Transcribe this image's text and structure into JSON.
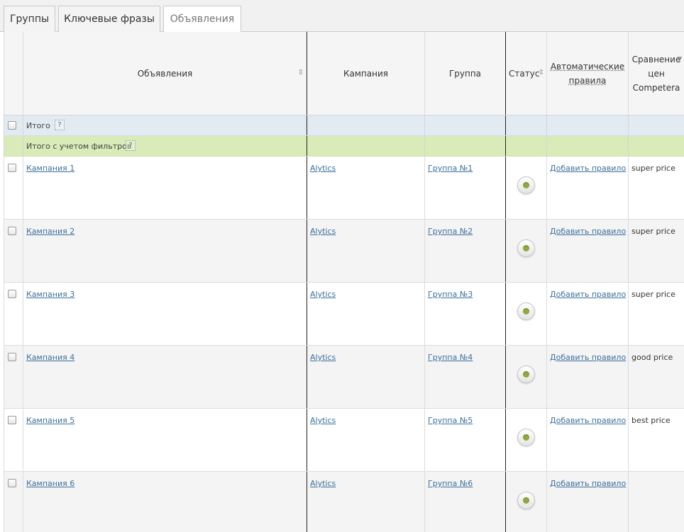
{
  "tabs": [
    "Группы",
    "Ключевые фразы",
    "Объявления"
  ],
  "header": {
    "ads": "Объявления",
    "campaign": "Кампания",
    "group": "Группа",
    "status": "Статус",
    "rules_line1": "Автоматические",
    "rules_line2": "правила",
    "compare_line1": "Сравнение",
    "compare_line2": "цен",
    "compare_line3": "Competera"
  },
  "summary": {
    "total_label": "Итого",
    "filtered_label": "Итого с учетом фильтров",
    "help": "?"
  },
  "rows": [
    {
      "ad": "Кампания 1",
      "campaign": "Alytics",
      "group": "Группа №1",
      "rule": "Добавить правило",
      "price": "super price"
    },
    {
      "ad": "Кампания 2",
      "campaign": "Alytics",
      "group": "Группа №2",
      "rule": "Добавить правило",
      "price": "super price"
    },
    {
      "ad": "Кампания 3",
      "campaign": "Alytics",
      "group": "Группа №3",
      "rule": "Добавить правило",
      "price": "super price"
    },
    {
      "ad": "Кампания 4",
      "campaign": "Alytics",
      "group": "Группа №4",
      "rule": "Добавить правило",
      "price": "good price"
    },
    {
      "ad": "Кампания 5",
      "campaign": "Alytics",
      "group": "Группа №5",
      "rule": "Добавить правило",
      "price": "best price"
    },
    {
      "ad": "Кампания 6",
      "campaign": "Alytics",
      "group": "Группа №6",
      "rule": "Добавить правило",
      "price": ""
    }
  ],
  "colors": {
    "link": "#3c6f9c",
    "total_bg": "#e2ebf2",
    "filtered_bg": "#d9ebb8",
    "status_on": "#8faa3a"
  }
}
